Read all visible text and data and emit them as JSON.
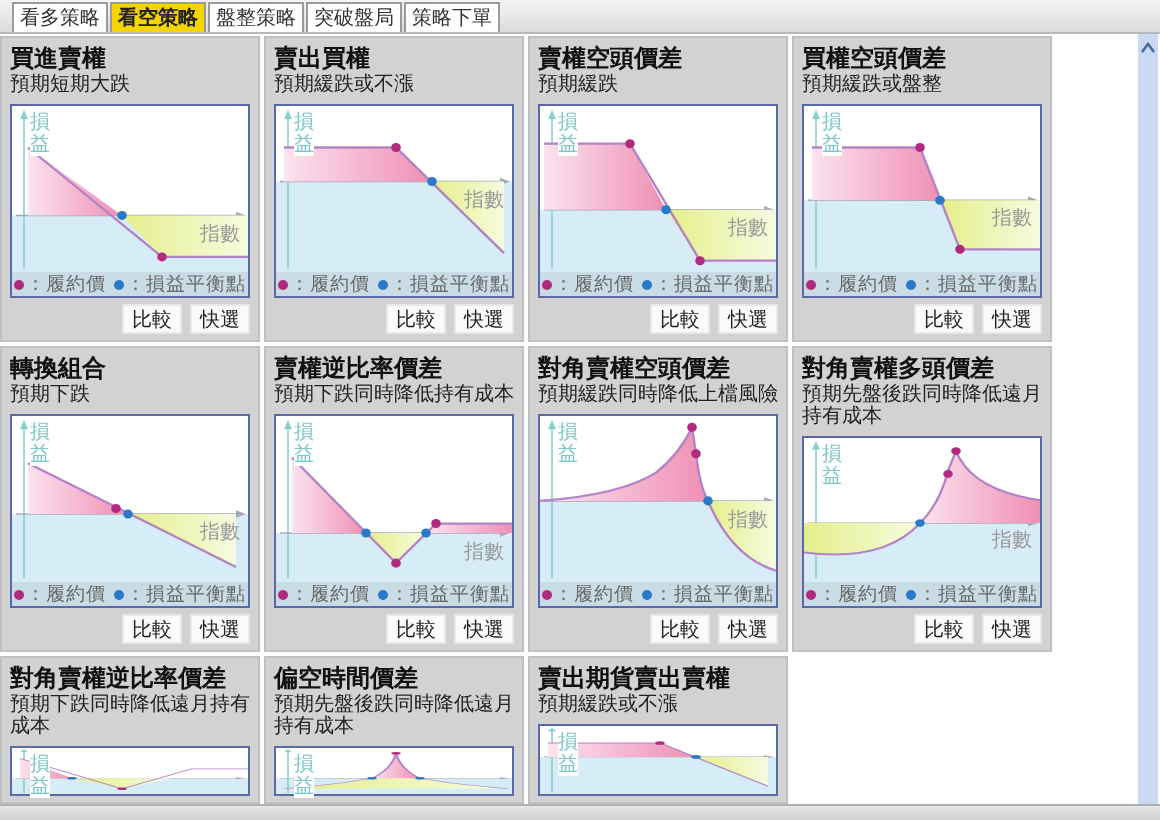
{
  "tabs": [
    {
      "label": "看多策略",
      "selected": false
    },
    {
      "label": "看空策略",
      "selected": true
    },
    {
      "label": "盤整策略",
      "selected": false
    },
    {
      "label": "突破盤局",
      "selected": false
    },
    {
      "label": "策略下單",
      "selected": false
    }
  ],
  "strategies": [
    {
      "title": "買進賣權",
      "subtitle": "預期短期大跌",
      "diagram": {
        "kind": "long-put"
      },
      "axis_y": "損益",
      "axis_x": "指數",
      "legend": [
        "：履約價",
        "：損益平衡點"
      ],
      "buttons": [
        "比較",
        "快選"
      ]
    },
    {
      "title": "賣出買權",
      "subtitle": "預期緩跌或不漲",
      "diagram": {
        "kind": "short-call"
      },
      "axis_y": "損益",
      "axis_x": "指數",
      "legend": [
        "：履約價",
        "：損益平衡點"
      ],
      "buttons": [
        "比較",
        "快選"
      ]
    },
    {
      "title": "賣權空頭價差",
      "subtitle": "預期緩跌",
      "diagram": {
        "kind": "bear-put"
      },
      "axis_y": "損益",
      "axis_x": "指數",
      "legend": [
        "：履約價",
        "：損益平衡點"
      ],
      "buttons": [
        "比較",
        "快選"
      ]
    },
    {
      "title": "買權空頭價差",
      "subtitle": "預期緩跌或盤整",
      "diagram": {
        "kind": "bear-call"
      },
      "axis_y": "損益",
      "axis_x": "指數",
      "legend": [
        "：履約價",
        "：損益平衡點"
      ],
      "buttons": [
        "比較",
        "快選"
      ]
    },
    {
      "title": "轉換組合",
      "subtitle": "預期下跌",
      "diagram": {
        "kind": "conversion"
      },
      "axis_y": "損益",
      "axis_x": "指數",
      "legend": [
        "：履約價",
        "：損益平衡點"
      ],
      "buttons": [
        "比較",
        "快選"
      ]
    },
    {
      "title": "賣權逆比率價差",
      "subtitle": "預期下跌同時降低持有成本",
      "diagram": {
        "kind": "put-ratio"
      },
      "axis_y": "損益",
      "axis_x": "指數",
      "legend": [
        "：履約價",
        "：損益平衡點"
      ],
      "buttons": [
        "比較",
        "快選"
      ]
    },
    {
      "title": "對角賣權空頭價差",
      "subtitle": "預期緩跌同時降低上檔風險",
      "diagram": {
        "kind": "diagonal-bear"
      },
      "axis_y": "損益",
      "axis_x": "指數",
      "legend": [
        "：履約價",
        "：損益平衡點"
      ],
      "buttons": [
        "比較",
        "快選"
      ]
    },
    {
      "title": "對角賣權多頭價差",
      "subtitle": "預期先盤後跌同時降低遠月持有成本",
      "diagram": {
        "kind": "diagonal-bull"
      },
      "axis_y": "損益",
      "axis_x": "指數",
      "legend": [
        "：履約價",
        "：損益平衡點"
      ],
      "buttons": [
        "比較",
        "快選"
      ]
    },
    {
      "title": "對角賣權逆比率價差",
      "subtitle": "預期下跌同時降低遠月持有成本",
      "diagram": {
        "kind": "diagonal-ratio"
      },
      "axis_y": "損益"
    },
    {
      "title": "偏空時間價差",
      "subtitle": "預期先盤後跌同時降低遠月持有成本",
      "diagram": {
        "kind": "calendar"
      },
      "axis_y": "損益"
    },
    {
      "title": "賣出期貨賣出賣權",
      "subtitle": "預期緩跌或不漲",
      "diagram": {
        "kind": "short-call"
      },
      "axis_y": "損益"
    }
  ]
}
